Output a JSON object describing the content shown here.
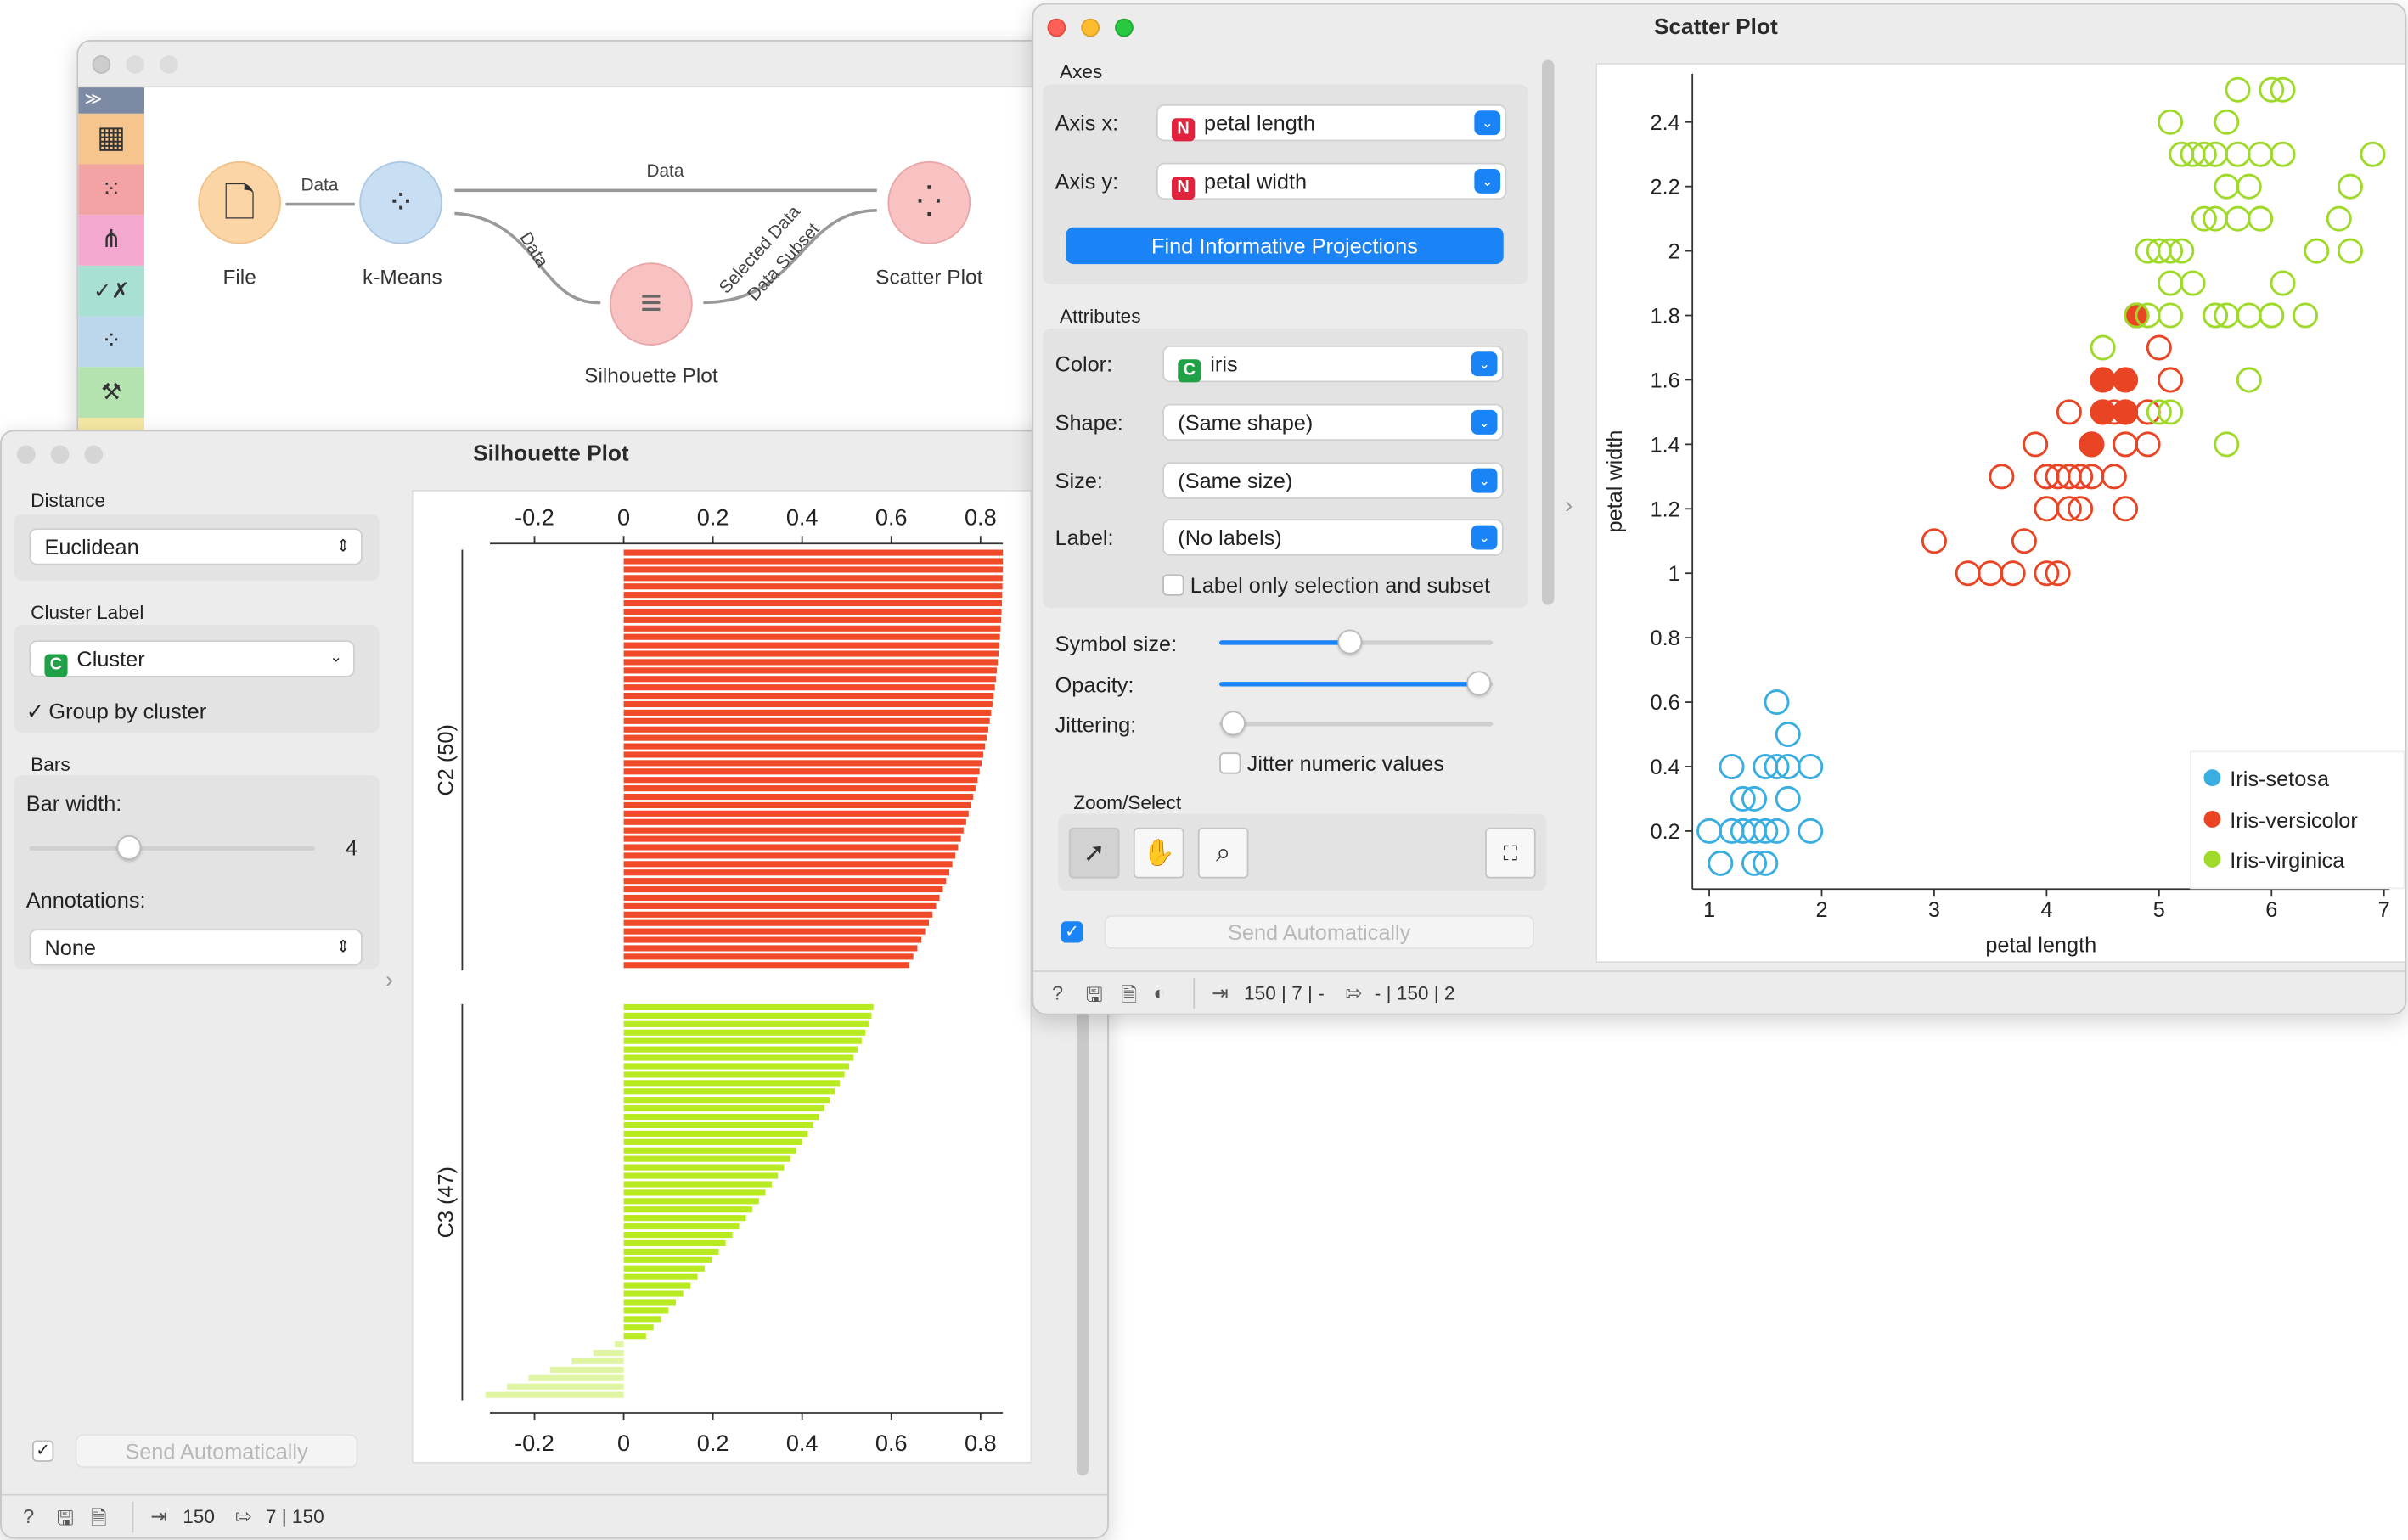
{
  "canvas": {
    "nodes": {
      "file": "File",
      "kmeans": "k-Means",
      "silhouette": "Silhouette Plot",
      "scatter": "Scatter Plot"
    },
    "links": {
      "file_kmeans": "Data",
      "kmeans_scatter": "Data",
      "kmeans_silhouette": "Data",
      "silhouette_scatter_1": "Selected Data",
      "silhouette_scatter_2": "Data Subset"
    },
    "toolbox_icons": [
      "expand-icon",
      "table-icon",
      "scatter-icon",
      "tree-icon",
      "test-score-icon",
      "clusters-icon",
      "explain-icon"
    ]
  },
  "silhouette": {
    "title": "Silhouette Plot",
    "distance_section": "Distance",
    "distance_value": "Euclidean",
    "cluster_label_section": "Cluster Label",
    "cluster_tag": "C",
    "cluster_value": "Cluster",
    "group_by_cluster": "Group by cluster",
    "bars_section": "Bars",
    "bar_width_label": "Bar width:",
    "bar_width_value": "4",
    "bar_width_fraction": 0.35,
    "annotations_label": "Annotations:",
    "annotations_value": "None",
    "send_auto": "Send Automatically",
    "status_in": "150",
    "status_out": "7 | 150",
    "colors": {
      "c2": "#f04a28",
      "c3": "#b8ea22",
      "c3_neg": "#dff5a3"
    }
  },
  "scatter": {
    "title": "Scatter Plot",
    "axes_section": "Axes",
    "axis_x_label": "Axis x:",
    "axis_x_tag": "N",
    "axis_x_value": "petal length",
    "axis_y_label": "Axis y:",
    "axis_y_tag": "N",
    "axis_y_value": "petal width",
    "find_projections": "Find Informative Projections",
    "attributes_section": "Attributes",
    "color_label": "Color:",
    "color_tag": "C",
    "color_value": "iris",
    "shape_label": "Shape:",
    "shape_value": "(Same shape)",
    "size_label": "Size:",
    "size_value": "(Same size)",
    "label_label": "Label:",
    "label_value": "(No labels)",
    "label_only": "Label only selection and subset",
    "symbol_size_label": "Symbol size:",
    "symbol_size_fraction": 0.48,
    "opacity_label": "Opacity:",
    "opacity_fraction": 0.95,
    "jittering_label": "Jittering:",
    "jittering_fraction": 0.0,
    "jitter_numeric": "Jitter numeric values",
    "zoom_section": "Zoom/Select",
    "send_auto": "Send Automatically",
    "status_in": "150 | 7 | -",
    "status_out": "- | 150 | 2",
    "tag_colors": {
      "N": "#e0223c",
      "C": "#21a147"
    }
  },
  "chart_data": [
    {
      "type": "bar",
      "orientation": "horizontal",
      "xlim": [
        -0.3,
        0.85
      ],
      "xticks": [
        "-0.2",
        "0",
        "0.2",
        "0.4",
        "0.6",
        "0.8"
      ],
      "xtick_values": [
        -0.2,
        0,
        0.2,
        0.4,
        0.6,
        0.8
      ],
      "groups": [
        {
          "name": "C2 (50)",
          "color": "#f04a28",
          "count": 50,
          "max": 0.85,
          "min": 0.64
        },
        {
          "name": "C3 (47)",
          "color": "#b8ea22",
          "count": 47,
          "max": 0.56,
          "min": -0.31
        }
      ]
    },
    {
      "type": "scatter",
      "xlabel": "petal length",
      "ylabel": "petal width",
      "xlim": [
        0.85,
        7.05
      ],
      "ylim": [
        0.02,
        2.55
      ],
      "xticks": [
        1,
        2,
        3,
        4,
        5,
        6,
        7
      ],
      "yticks": [
        0.2,
        0.4,
        0.6,
        0.8,
        1,
        1.2,
        1.4,
        1.6,
        1.8,
        2,
        2.2,
        2.4
      ],
      "legend_position": "bottom-right",
      "series": [
        {
          "name": "Iris-setosa",
          "color": "#3aaee0",
          "points": [
            [
              1.4,
              0.2
            ],
            [
              1.3,
              0.2
            ],
            [
              1.5,
              0.2
            ],
            [
              1.7,
              0.4
            ],
            [
              1.4,
              0.3
            ],
            [
              1.5,
              0.1
            ],
            [
              1.6,
              0.2
            ],
            [
              1.1,
              0.1
            ],
            [
              1.2,
              0.2
            ],
            [
              1.7,
              0.3
            ],
            [
              1.9,
              0.2
            ],
            [
              1.5,
              0.4
            ],
            [
              1.0,
              0.2
            ],
            [
              1.7,
              0.5
            ],
            [
              1.9,
              0.4
            ],
            [
              1.6,
              0.4
            ],
            [
              1.3,
              0.3
            ],
            [
              1.6,
              0.6
            ],
            [
              1.4,
              0.1
            ],
            [
              1.2,
              0.4
            ]
          ]
        },
        {
          "name": "Iris-versicolor",
          "color": "#e94424",
          "points": [
            [
              4.7,
              1.4
            ],
            [
              4.5,
              1.5
            ],
            [
              4.9,
              1.5
            ],
            [
              4.0,
              1.3
            ],
            [
              4.6,
              1.5
            ],
            [
              3.3,
              1.0
            ],
            [
              4.6,
              1.3
            ],
            [
              3.9,
              1.4
            ],
            [
              3.5,
              1.0
            ],
            [
              4.2,
              1.5
            ],
            [
              4.0,
              1.0
            ],
            [
              4.7,
              1.4
            ],
            [
              3.6,
              1.3
            ],
            [
              4.4,
              1.4
            ],
            [
              4.1,
              1.0
            ],
            [
              4.8,
              1.8
            ],
            [
              4.0,
              1.3
            ],
            [
              4.9,
              1.5
            ],
            [
              4.7,
              1.2
            ],
            [
              4.3,
              1.3
            ],
            [
              4.4,
              1.4
            ],
            [
              5.0,
              1.7
            ],
            [
              4.5,
              1.5
            ],
            [
              3.8,
              1.1
            ],
            [
              3.7,
              1.0
            ],
            [
              5.1,
              1.6
            ],
            [
              4.5,
              1.6
            ],
            [
              4.7,
              1.5
            ],
            [
              4.4,
              1.3
            ],
            [
              4.1,
              1.3
            ],
            [
              4.0,
              1.2
            ],
            [
              3.0,
              1.1
            ],
            [
              4.2,
              1.2
            ],
            [
              4.3,
              1.2
            ],
            [
              4.9,
              1.4
            ],
            [
              4.2,
              1.3
            ]
          ],
          "selected": [
            [
              4.8,
              1.8
            ],
            [
              4.7,
              1.6
            ],
            [
              4.5,
              1.6
            ],
            [
              4.5,
              1.5
            ],
            [
              4.4,
              1.4
            ],
            [
              4.7,
              1.5
            ]
          ]
        },
        {
          "name": "Iris-virginica",
          "color": "#9fd92a",
          "points": [
            [
              6.0,
              2.5
            ],
            [
              5.1,
              1.9
            ],
            [
              5.9,
              2.1
            ],
            [
              5.6,
              1.8
            ],
            [
              5.8,
              2.2
            ],
            [
              6.6,
              2.1
            ],
            [
              4.5,
              1.7
            ],
            [
              6.3,
              1.8
            ],
            [
              5.8,
              1.8
            ],
            [
              6.1,
              2.5
            ],
            [
              5.1,
              2.0
            ],
            [
              5.3,
              1.9
            ],
            [
              5.5,
              2.1
            ],
            [
              5.0,
              2.0
            ],
            [
              5.1,
              2.4
            ],
            [
              5.3,
              2.3
            ],
            [
              5.5,
              1.8
            ],
            [
              6.7,
              2.2
            ],
            [
              6.9,
              2.3
            ],
            [
              5.0,
              1.5
            ],
            [
              5.7,
              2.3
            ],
            [
              4.9,
              2.0
            ],
            [
              6.7,
              2.0
            ],
            [
              4.9,
              1.8
            ],
            [
              5.7,
              2.1
            ],
            [
              6.0,
              1.8
            ],
            [
              4.8,
              1.8
            ],
            [
              5.8,
              1.6
            ],
            [
              6.1,
              1.9
            ],
            [
              6.4,
              2.0
            ],
            [
              5.6,
              2.2
            ],
            [
              5.1,
              1.5
            ],
            [
              5.6,
              1.4
            ],
            [
              6.1,
              2.3
            ],
            [
              5.6,
              2.4
            ],
            [
              5.5,
              1.8
            ],
            [
              5.4,
              2.1
            ],
            [
              5.2,
              2.3
            ],
            [
              5.9,
              2.3
            ],
            [
              5.7,
              2.5
            ],
            [
              5.2,
              2.0
            ],
            [
              5.4,
              2.3
            ],
            [
              5.1,
              1.8
            ],
            [
              5.5,
              2.3
            ],
            [
              6.0,
              1.8
            ],
            [
              5.9,
              2.1
            ]
          ]
        }
      ]
    }
  ]
}
